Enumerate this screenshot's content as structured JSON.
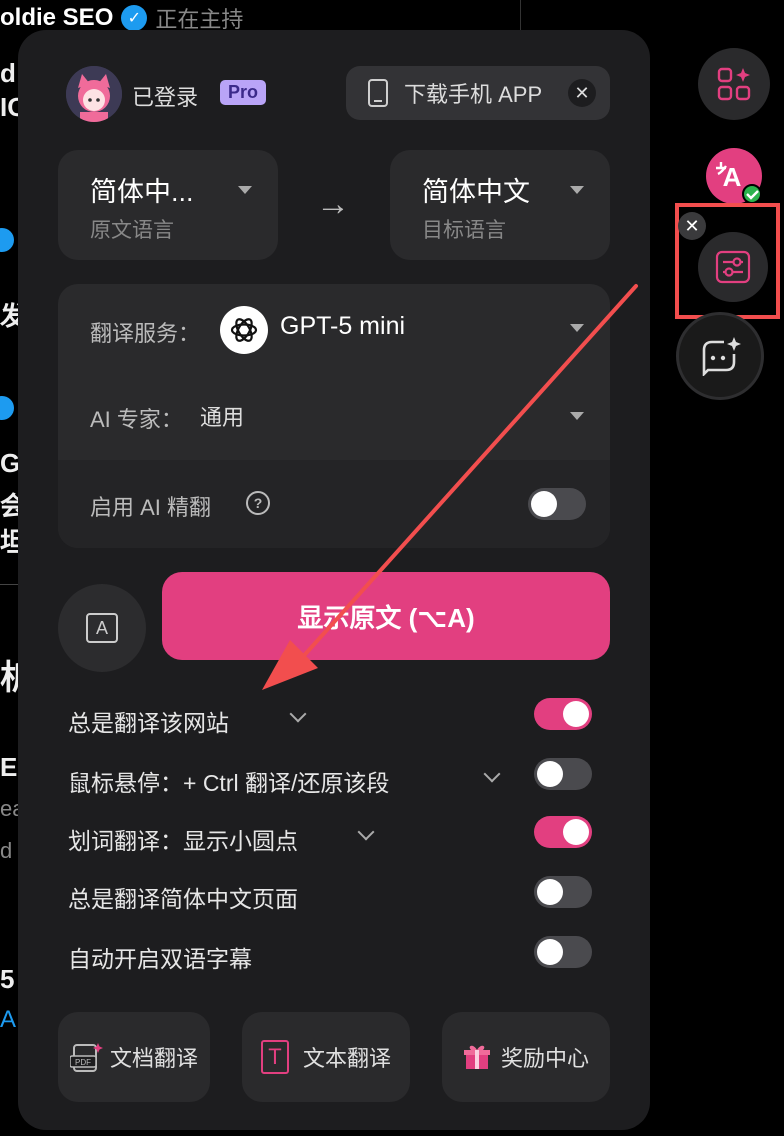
{
  "background": {
    "user_name": "oldie SEO",
    "hosting": "正在主持",
    "fragments": [
      "d",
      "IC",
      "发",
      "Ge",
      "会是",
      "坦扌",
      "析",
      "E",
      "ea",
      "d",
      "5",
      "A"
    ]
  },
  "header": {
    "login_status": "已登录",
    "pro_badge": "Pro",
    "download_app": "下载手机 APP",
    "close_symbol": "✕"
  },
  "languages": {
    "source": {
      "value": "简体中...",
      "label": "原文语言"
    },
    "arrow": "→",
    "target": {
      "value": "简体中文",
      "label": "目标语言"
    }
  },
  "service": {
    "label": "翻译服务：",
    "value": "GPT-5 mini",
    "expert_label": "AI 专家：",
    "expert_value": "通用",
    "ai_refine_label": "启用 AI 精翻",
    "ai_refine_help": "?",
    "ai_refine_on": false
  },
  "actions": {
    "show_original": "显示原文 (⌥A)",
    "font_icon": "A"
  },
  "options": [
    {
      "label": "总是翻译该网站",
      "on": true
    },
    {
      "label": "鼠标悬停：+ Ctrl 翻译/还原该段",
      "on": false
    },
    {
      "label": "划词翻译：显示小圆点",
      "on": true
    },
    {
      "label": "总是翻译简体中文页面",
      "on": false
    },
    {
      "label": "自动开启双语字幕",
      "on": false
    }
  ],
  "tools": {
    "doc_translate": "文档翻译",
    "text_translate": "文本翻译",
    "text_icon": "T",
    "rewards": "奖励中心",
    "pdf_icon_text": "PDF"
  },
  "side": {
    "close_symbol": "✕",
    "ai_badge": "A"
  },
  "colors": {
    "accent": "#e23f80",
    "panel": "#1d1d1f",
    "annotation": "#f24e4e",
    "pro_badge": "#b9a4f7",
    "verified": "#1d9bf0"
  }
}
